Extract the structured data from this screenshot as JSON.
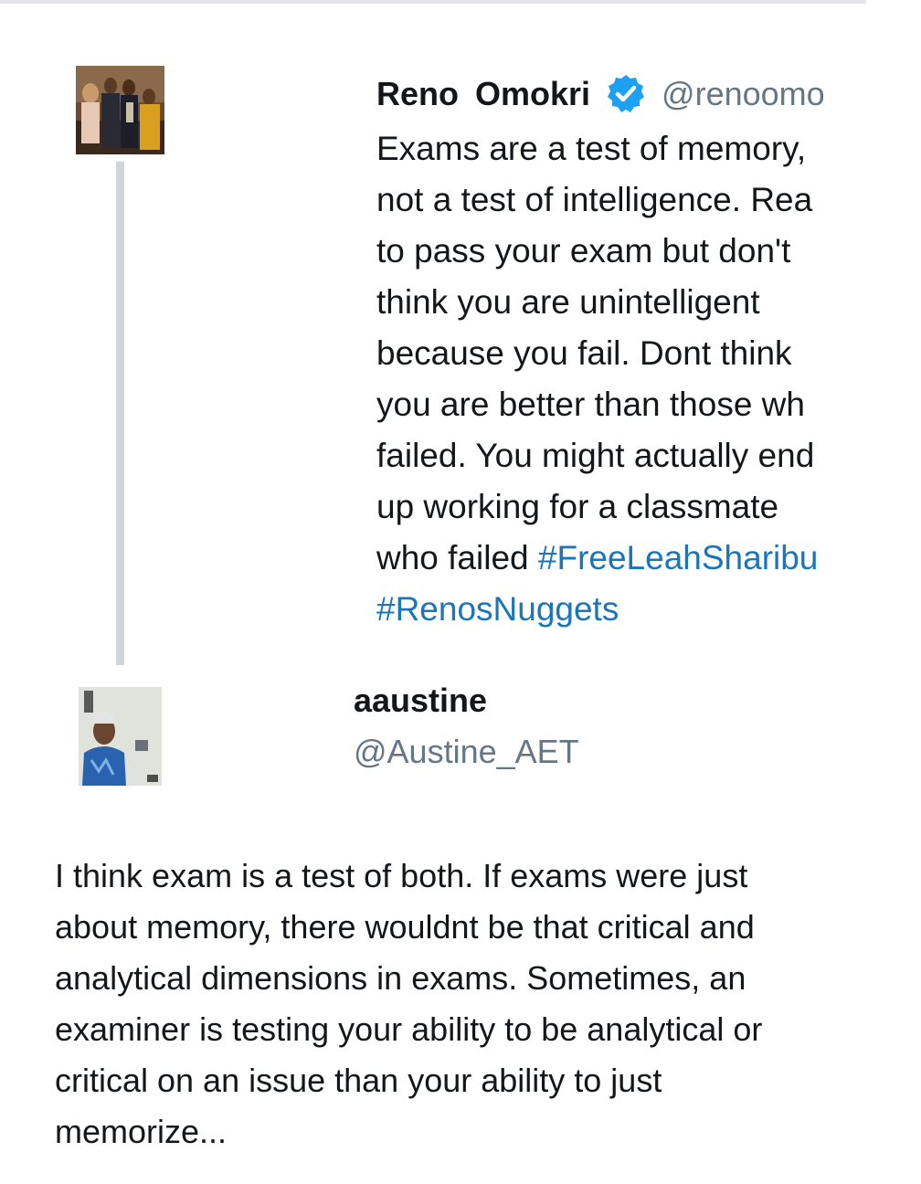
{
  "original_tweet": {
    "author_name": "Reno Omokri",
    "handle": "@renoomo",
    "verified_icon": "verified-badge-icon",
    "text_lines": [
      "Exams are a test of memory,",
      "not a test of intelligence. Rea",
      "to pass your exam but don't",
      "think you are unintelligent",
      "because you fail. Dont think",
      "you are better than those wh",
      "failed. You might actually end",
      "up working for a classmate",
      "who failed "
    ],
    "hashtags": [
      "#FreeLeahSharibu",
      "#RenosNuggets"
    ]
  },
  "reply": {
    "author_name": "aaustine",
    "handle": "@Austine_AET",
    "text_lines": [
      "I think exam is a test of both. If exams were just",
      "about memory, there wouldnt be that critical and",
      "analytical dimensions in exams. Sometimes, an",
      "examiner is testing your ability to be analytical or",
      "critical on an issue than your ability to just",
      "memorize..."
    ]
  },
  "colors": {
    "hashtag": "#1b75bb",
    "handle": "#657786",
    "verified": "#1da1f2",
    "thread_line": "#cfd5da"
  }
}
